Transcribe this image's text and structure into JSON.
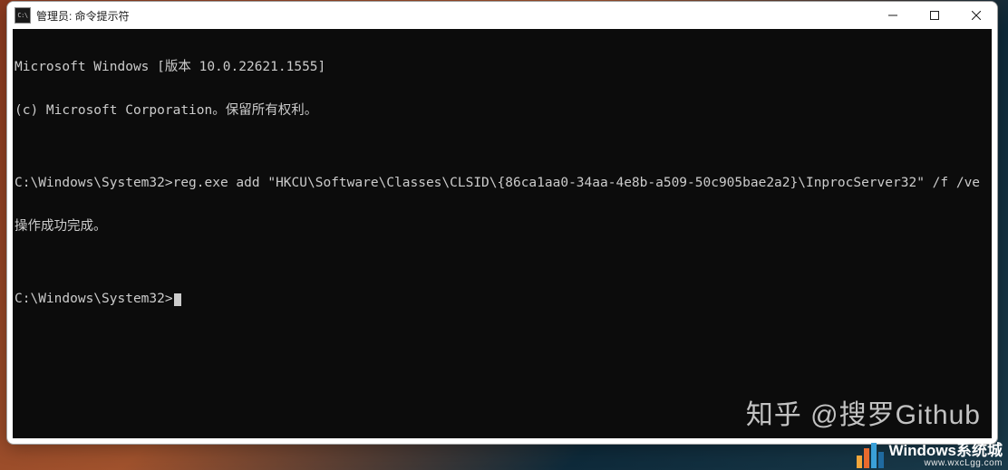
{
  "window": {
    "title": "管理员: 命令提示符",
    "icon_label": "C:\\"
  },
  "controls": {
    "minimize_label": "Minimize",
    "maximize_label": "Maximize",
    "close_label": "Close"
  },
  "terminal": {
    "lines": [
      "Microsoft Windows [版本 10.0.22621.1555]",
      "(c) Microsoft Corporation。保留所有权利。",
      "",
      "C:\\Windows\\System32>reg.exe add \"HKCU\\Software\\Classes\\CLSID\\{86ca1aa0-34aa-4e8b-a509-50c905bae2a2}\\InprocServer32\" /f /ve",
      "操作成功完成。",
      "",
      "C:\\Windows\\System32>"
    ],
    "prompt_path": "C:\\Windows\\System32",
    "last_command": "reg.exe add \"HKCU\\Software\\Classes\\CLSID\\{86ca1aa0-34aa-4e8b-a509-50c905bae2a2}\\InprocServer32\" /f /ve",
    "result_message": "操作成功完成。"
  },
  "watermarks": {
    "zhihu": "知乎 @搜罗Github",
    "brand_main": "Windows系统城",
    "brand_sub": "www.wxcLgg.com"
  }
}
